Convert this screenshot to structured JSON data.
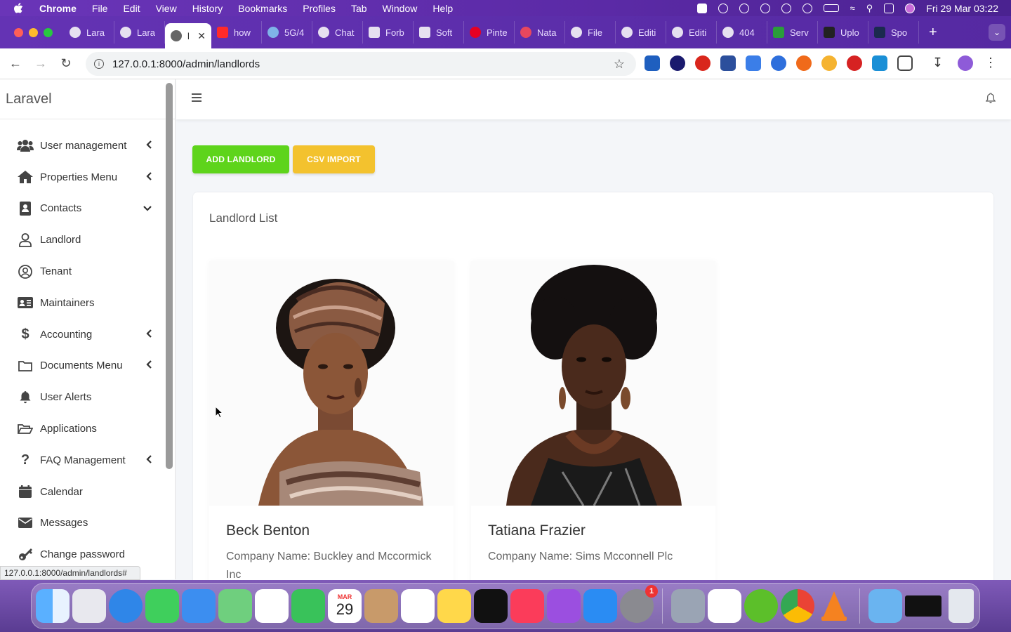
{
  "menubar": {
    "app": "Chrome",
    "items": [
      "File",
      "Edit",
      "View",
      "History",
      "Bookmarks",
      "Profiles",
      "Tab",
      "Window",
      "Help"
    ],
    "clock": "Fri 29 Mar  03:22"
  },
  "tabs": [
    {
      "label": "Lara"
    },
    {
      "label": "Lara"
    },
    {
      "label": "l",
      "active": true
    },
    {
      "label": "how"
    },
    {
      "label": "5G/4"
    },
    {
      "label": "Chat"
    },
    {
      "label": "Forb"
    },
    {
      "label": "Soft"
    },
    {
      "label": "Pinte"
    },
    {
      "label": "Nata"
    },
    {
      "label": "File"
    },
    {
      "label": "Editi"
    },
    {
      "label": "Editi"
    },
    {
      "label": "404"
    },
    {
      "label": "Serv"
    },
    {
      "label": "Uplo"
    },
    {
      "label": "Spo"
    }
  ],
  "address": {
    "url": "127.0.0.1:8000/admin/landlords"
  },
  "sidebar": {
    "brand": "Laravel",
    "items": [
      {
        "label": "User management",
        "icon": "users-icon",
        "arrow": "left"
      },
      {
        "label": "Properties Menu",
        "icon": "home-icon",
        "arrow": "left"
      },
      {
        "label": "Contacts",
        "icon": "address-book-icon",
        "arrow": "down"
      },
      {
        "label": "Landlord",
        "icon": "user-icon",
        "arrow": ""
      },
      {
        "label": "Tenant",
        "icon": "user-circle-icon",
        "arrow": ""
      },
      {
        "label": "Maintainers",
        "icon": "id-card-icon",
        "arrow": ""
      },
      {
        "label": "Accounting",
        "icon": "dollar-icon",
        "arrow": "left"
      },
      {
        "label": "Documents Menu",
        "icon": "folder-icon",
        "arrow": "left"
      },
      {
        "label": "User Alerts",
        "icon": "bell-icon",
        "arrow": ""
      },
      {
        "label": "Applications",
        "icon": "folder-open-icon",
        "arrow": ""
      },
      {
        "label": "FAQ Management",
        "icon": "question-icon",
        "arrow": "left"
      },
      {
        "label": "Calendar",
        "icon": "calendar-icon",
        "arrow": ""
      },
      {
        "label": "Messages",
        "icon": "envelope-icon",
        "arrow": ""
      },
      {
        "label": "Change password",
        "icon": "key-icon",
        "arrow": ""
      }
    ]
  },
  "actions": {
    "add_label": "ADD LANDLORD",
    "csv_label": "CSV IMPORT"
  },
  "list": {
    "title": "Landlord List",
    "landlords": [
      {
        "name": "Beck Benton",
        "company": "Company Name: Buckley and Mccormick Inc"
      },
      {
        "name": "Tatiana Frazier",
        "company": "Company Name: Sims Mcconnell Plc"
      }
    ]
  },
  "statusbar": {
    "link": "127.0.0.1:8000/admin/landlords#"
  },
  "dock": {
    "calendar_month": "MAR",
    "calendar_day": "29",
    "settings_badge": "1"
  },
  "colors": {
    "add_button": "#5ed41b",
    "csv_button": "#f3c22e",
    "chrome_frame": "#5b2aa6"
  }
}
